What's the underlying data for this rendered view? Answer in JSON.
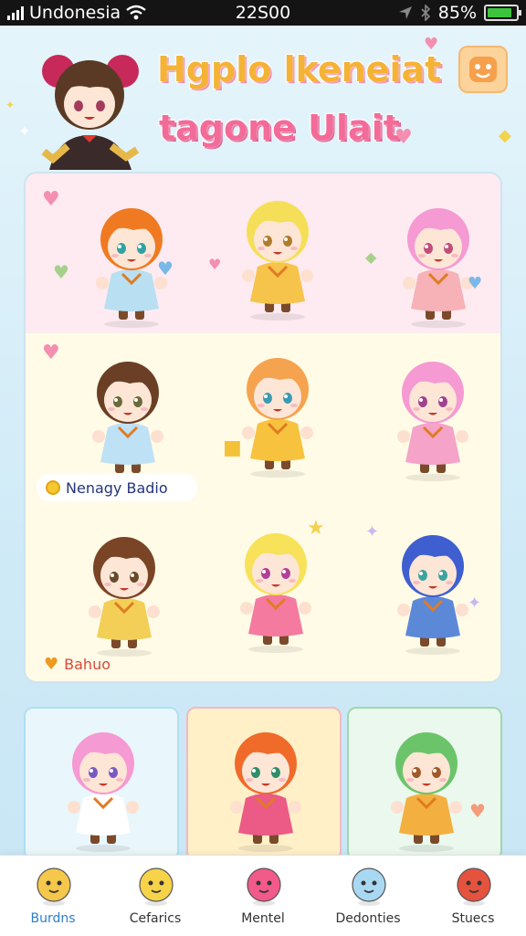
{
  "status_bar": {
    "carrier": "Undonesia",
    "time": "22S00",
    "battery": "85%",
    "battery_level": 0.85
  },
  "header": {
    "title_line1": "Hgplo lkeneiat",
    "title_line2": "tagone Ulait"
  },
  "grid": {
    "row2_chip": "Nenagy Badio",
    "row3_chip": "Bahuo"
  },
  "tabs": [
    {
      "label": "Burdns",
      "icon": "character-icon"
    },
    {
      "label": "Cefarics",
      "icon": "character-icon"
    },
    {
      "label": "Mentel",
      "icon": "character-icon"
    },
    {
      "label": "Dedonties",
      "icon": "character-icon"
    },
    {
      "label": "Stuecs",
      "icon": "character-icon"
    }
  ],
  "colors": {
    "title_yellow": "#f4b334",
    "title_pink": "#f36b98",
    "accent_blue": "#25357a",
    "active_tab": "#2a7fc9"
  }
}
